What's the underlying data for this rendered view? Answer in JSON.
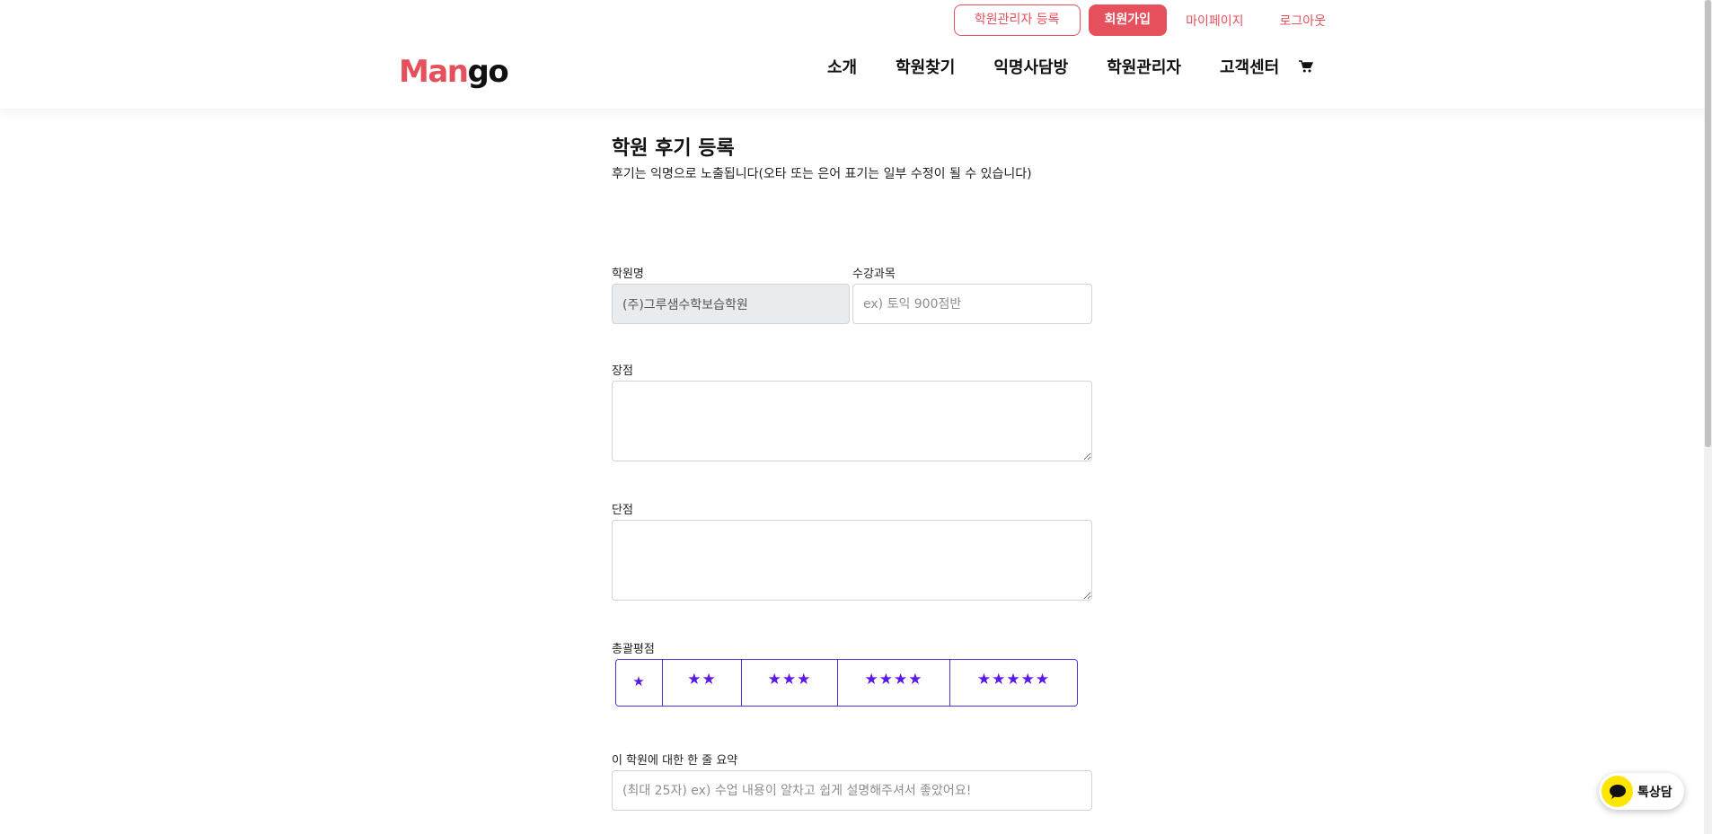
{
  "header": {
    "logo": {
      "part1": "Man",
      "part2": "go"
    },
    "top_links": {
      "academy_admin_register": "학원관리자 등록",
      "signup": "회원가입",
      "mypage": "마이페이지",
      "logout": "로그아웃"
    },
    "nav": [
      "소개",
      "학원찾기",
      "익명사담방",
      "학원관리자",
      "고객센터"
    ],
    "cart_icon": "cart-icon"
  },
  "page": {
    "title": "학원 후기 등록",
    "subtitle": "후기는 익명으로 노출됩니다(오타 또는 은어 표기는 일부 수정이 될 수 있습니다)"
  },
  "form": {
    "academy_name": {
      "label": "학원명",
      "value": "(주)그루샘수학보습학원"
    },
    "course": {
      "label": "수강과목",
      "placeholder": "ex) 토익 900점반"
    },
    "pros": {
      "label": "장점"
    },
    "cons": {
      "label": "단점"
    },
    "rating": {
      "label": "총괄평점",
      "options": [
        "★",
        "★★",
        "★★★",
        "★★★★",
        "★★★★★"
      ]
    },
    "summary": {
      "label": "이 학원에 대한 한 줄 요약",
      "placeholder": "(최대 25자) ex) 수업 내용이 알차고 쉽게 설명해주셔서 좋았어요!"
    }
  },
  "widget": {
    "label": "톡상담",
    "icon": "chat-bubble-icon"
  },
  "colors": {
    "brand": "#e5505c",
    "rating_accent": "#5b17e8",
    "kakao_yellow": "#fee500"
  }
}
